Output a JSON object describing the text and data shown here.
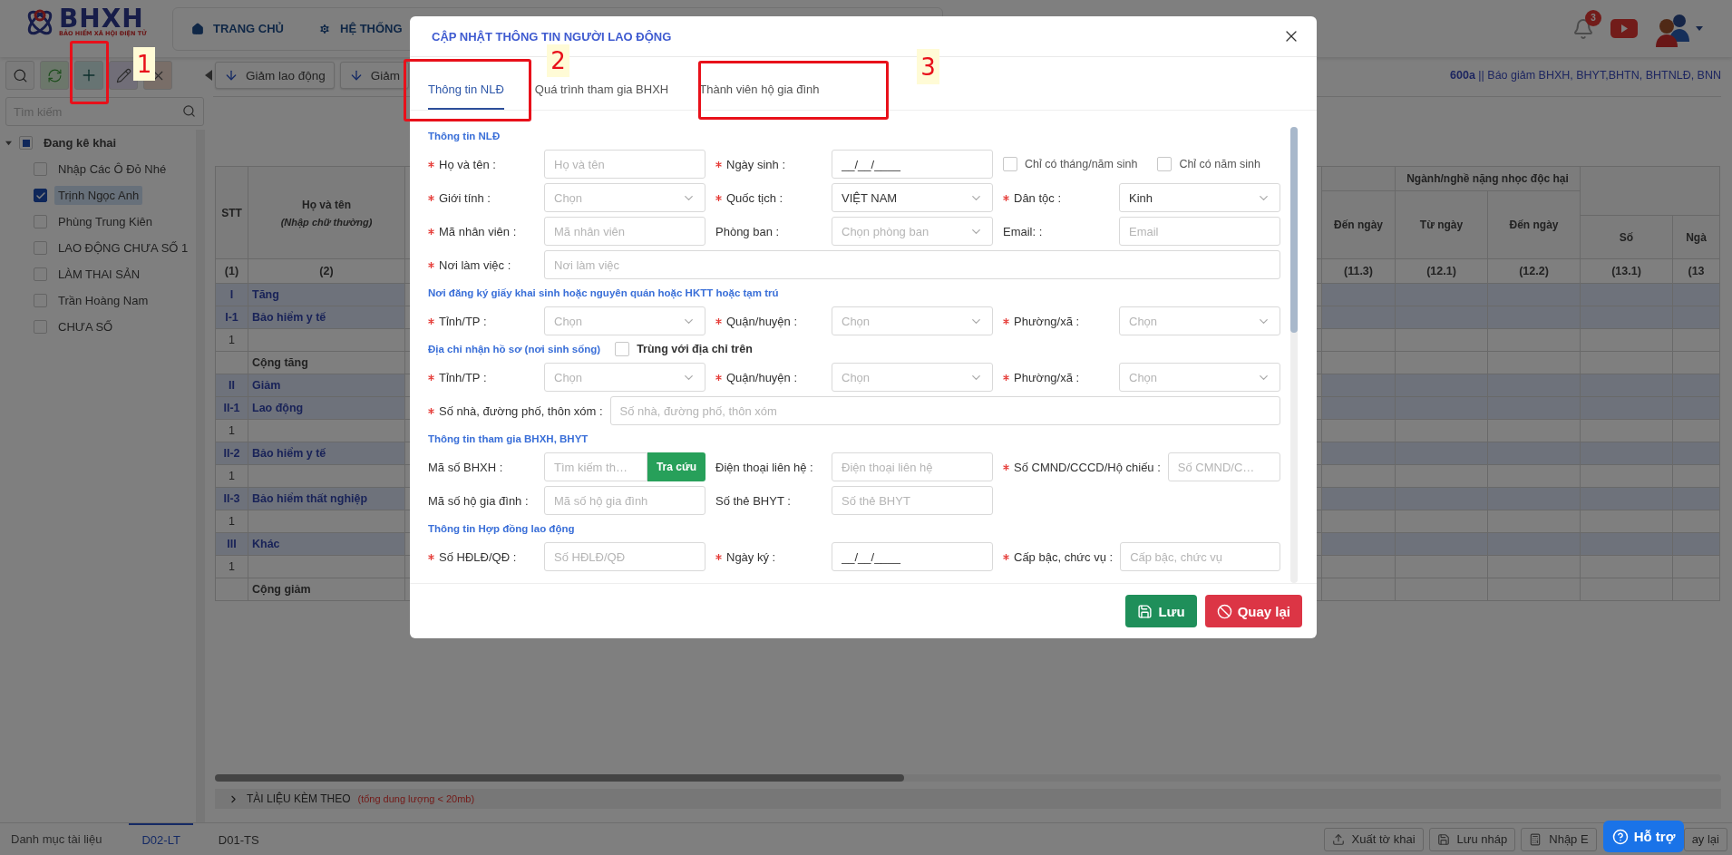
{
  "header": {
    "logo": {
      "title": "BHXH",
      "subtitle": "BẢO HIỂM XÃ HỘI ĐIỆN TỬ"
    },
    "nav": [
      {
        "label": "TRANG CHỦ",
        "kind": "home"
      },
      {
        "label": "HỆ THỐNG",
        "kind": "system"
      }
    ],
    "notifications": {
      "count": "3"
    }
  },
  "toolbar": {
    "tools": [
      {
        "kind": "search"
      },
      {
        "kind": "refresh"
      },
      {
        "kind": "add"
      },
      {
        "kind": "edit"
      },
      {
        "kind": "delete"
      }
    ],
    "actions": [
      {
        "label": "Giảm lao động"
      },
      {
        "label": "Giảm"
      }
    ],
    "form_title": "**600a** || Báo giảm BHXH, BHYT,BHTN, BHTNLĐ, BNN"
  },
  "sidebar": {
    "search": {
      "placeholder": "Tìm kiếm"
    },
    "tree": [
      {
        "label": "Đang kê khai",
        "expanded": true,
        "checked": false,
        "partial": true,
        "children": [
          {
            "label": "Nhập Các Ô Đỏ Nhé",
            "checked": false,
            "selected": false
          },
          {
            "label": "Trịnh Ngọc Anh",
            "checked": true,
            "selected": true
          },
          {
            "label": "Phùng Trung Kiên",
            "checked": false,
            "selected": false
          },
          {
            "label": "LAO ĐỘNG CHƯA SỐ 1",
            "checked": false,
            "selected": false
          },
          {
            "label": "LÀM THAI SẢN",
            "checked": false,
            "selected": false
          },
          {
            "label": "Trần Hoàng Nam",
            "checked": false,
            "selected": false
          },
          {
            "label": "CHƯA SỐ",
            "checked": false,
            "selected": false
          }
        ]
      }
    ]
  },
  "table": {
    "columns": [
      {
        "label": "STT"
      },
      {
        "label": "Họ và tên",
        "note": "(Nhập chữ thường)"
      },
      {
        "label": "Đến ngày"
      },
      {
        "label": "Từ ngày"
      },
      {
        "label": "Đến ngày"
      },
      {
        "label": "Số"
      },
      {
        "label": "Ngà"
      }
    ],
    "group_header": "Ngành/nghề nặng nhọc độc hại",
    "numbers": [
      "(1)",
      "(2)",
      "(11.3)",
      "(12.1)",
      "(12.2)",
      "(13.1)",
      "(13"
    ],
    "rows": [
      {
        "kind": "group",
        "stt": "I",
        "name": "Tăng"
      },
      {
        "kind": "group",
        "stt": "I-1",
        "name": "Bảo hiểm y tế"
      },
      {
        "kind": "item",
        "stt": "1"
      },
      {
        "kind": "total",
        "name": "Cộng tăng"
      },
      {
        "kind": "group",
        "stt": "II",
        "name": "Giảm"
      },
      {
        "kind": "group",
        "stt": "II-1",
        "name": "Lao động"
      },
      {
        "kind": "item",
        "stt": "1"
      },
      {
        "kind": "group",
        "stt": "II-2",
        "name": "Bảo hiểm y tế"
      },
      {
        "kind": "item",
        "stt": "1"
      },
      {
        "kind": "group",
        "stt": "II-3",
        "name": "Bảo hiểm thất nghiệp"
      },
      {
        "kind": "item",
        "stt": "1"
      },
      {
        "kind": "group",
        "stt": "III",
        "name": "Khác"
      },
      {
        "kind": "item",
        "stt": "1"
      },
      {
        "kind": "total",
        "name": "Cộng giảm"
      }
    ]
  },
  "attachments": {
    "label": "TÀI LIỆU KÈM THEO",
    "note": "(tổng dung lượng < 20mb)",
    "expanded": false
  },
  "bottom_tabs": {
    "title": "Danh mục tài liệu",
    "tabs": [
      {
        "label": "D02-LT",
        "selected": true
      },
      {
        "label": "D01-TS",
        "selected": false
      }
    ]
  },
  "bottom_actions": [
    {
      "label": "Xuất tờ khai",
      "kind": "export"
    },
    {
      "label": "Lưu nháp",
      "kind": "draft"
    },
    {
      "label": "Nhập E",
      "kind": "import"
    },
    {
      "label": "ay lại",
      "kind": "back"
    }
  ],
  "help": {
    "label": "Hỗ trợ"
  },
  "dialog": {
    "title": "CẬP NHẬT THÔNG TIN NGƯỜI LAO ĐỘNG",
    "tabs": [
      {
        "label": "Thông tin NLĐ",
        "selected": true
      },
      {
        "label": "Quá trình tham gia BHXH",
        "selected": false
      },
      {
        "label": "Thành viên hộ gia đình",
        "selected": false
      }
    ],
    "sections": [
      {
        "title": "Thông tin NLĐ",
        "rows": [
          [
            {
              "kind": "text",
              "label": "Họ và tên :",
              "required": true,
              "placeholder": "Họ và tên"
            },
            {
              "kind": "text",
              "label": "Ngày sinh :",
              "required": true,
              "value": "__/__/____"
            },
            {
              "kind": "checks",
              "options": [
                {
                  "label": "Chỉ có tháng/năm sinh",
                  "checked": false
                },
                {
                  "label": "Chỉ có năm sinh",
                  "checked": false
                }
              ]
            }
          ],
          [
            {
              "kind": "select",
              "label": "Giới tính :",
              "required": true,
              "placeholder": "Chọn"
            },
            {
              "kind": "select",
              "label": "Quốc tịch :",
              "required": true,
              "value": "VIỆT NAM"
            },
            {
              "kind": "select",
              "label": "Dân tộc :",
              "required": true,
              "value": "Kinh"
            }
          ],
          [
            {
              "kind": "text",
              "label": "Mã nhân viên :",
              "required": true,
              "placeholder": "Mã nhân viên"
            },
            {
              "kind": "select",
              "label": "Phòng ban :",
              "required": false,
              "placeholder": "Chọn phòng ban"
            },
            {
              "kind": "text",
              "label": "Email: :",
              "required": false,
              "placeholder": "Email"
            }
          ],
          [
            {
              "kind": "wide",
              "label": "Nơi làm việc :",
              "required": true,
              "placeholder": "Nơi làm việc"
            }
          ]
        ]
      },
      {
        "title": "Nơi đăng ký giấy khai sinh hoặc nguyên quán hoặc HKTT hoặc tạm trú",
        "rows": [
          [
            {
              "kind": "select",
              "label": "Tỉnh/TP :",
              "required": true,
              "placeholder": "Chọn"
            },
            {
              "kind": "select",
              "label": "Quận/huyện :",
              "required": true,
              "placeholder": "Chọn"
            },
            {
              "kind": "select",
              "label": "Phường/xã :",
              "required": true,
              "placeholder": "Chọn"
            }
          ]
        ]
      },
      {
        "title": "Địa chỉ nhận hồ sơ (nơi sinh sống)",
        "option": {
          "label": "Trùng với địa chỉ trên",
          "checked": false
        },
        "rows": [
          [
            {
              "kind": "select",
              "label": "Tỉnh/TP :",
              "required": true,
              "placeholder": "Chọn"
            },
            {
              "kind": "select",
              "label": "Quận/huyện :",
              "required": true,
              "placeholder": "Chọn"
            },
            {
              "kind": "select",
              "label": "Phường/xã :",
              "required": true,
              "placeholder": "Chọn"
            }
          ],
          [
            {
              "kind": "wide",
              "label": "Số nhà, đường phố, thôn xóm :",
              "required": true,
              "placeholder": "Số nhà, đường phố, thôn xóm"
            }
          ]
        ]
      },
      {
        "title": "Thông tin tham gia BHXH, BHYT",
        "rows": [
          [
            {
              "kind": "lookup",
              "label": "Mã số BHXH :",
              "required": false,
              "placeholder": "Tìm kiếm th…",
              "button": "Tra cứu"
            },
            {
              "kind": "text",
              "label": "Điện thoại liên hệ :",
              "required": false,
              "placeholder": "Điện thoại liên hệ"
            },
            {
              "kind": "text",
              "label": "Số CMND/CCCD/Hộ chiếu :",
              "required": true,
              "placeholder": "Số CMND/C…"
            }
          ],
          [
            {
              "kind": "text",
              "label": "Mã số hộ gia đình :",
              "required": false,
              "placeholder": "Mã số hộ gia đình"
            },
            {
              "kind": "text",
              "label": "Số thẻ BHYT :",
              "required": false,
              "placeholder": "Số thẻ BHYT"
            }
          ]
        ]
      },
      {
        "title": "Thông tin Hợp đồng lao động",
        "rows": [
          [
            {
              "kind": "text",
              "label": "Số HĐLĐ/QĐ :",
              "required": true,
              "placeholder": "Số HĐLĐ/QĐ"
            },
            {
              "kind": "text",
              "label": "Ngày ký :",
              "required": true,
              "value": "__/__/____"
            },
            {
              "kind": "text",
              "label": "Cấp bậc, chức vụ :",
              "required": true,
              "placeholder": "Cấp bậc, chức vụ"
            }
          ]
        ]
      }
    ],
    "buttons": [
      {
        "label": "Lưu",
        "kind": "save"
      },
      {
        "label": "Quay lại",
        "kind": "cancel"
      }
    ]
  },
  "annotations": [
    {
      "label": "1"
    },
    {
      "label": "2"
    },
    {
      "label": "3"
    }
  ]
}
